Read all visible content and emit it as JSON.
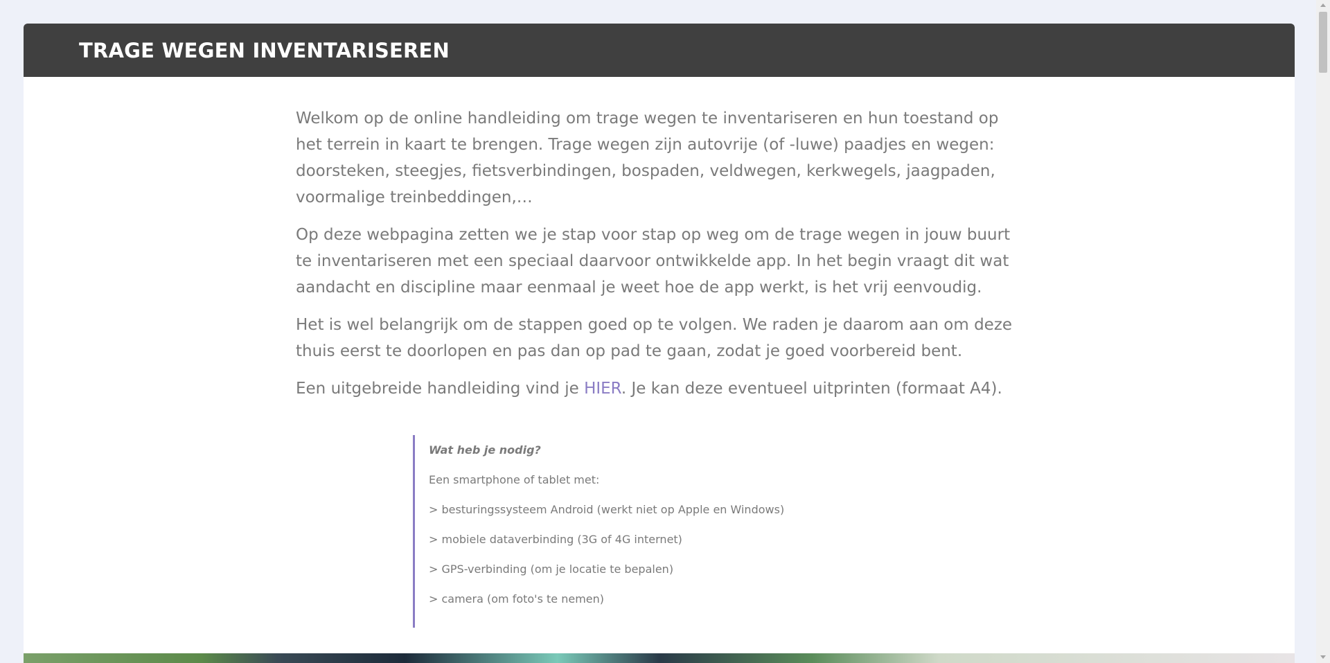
{
  "header": {
    "title": "TRAGE WEGEN INVENTARISEREN"
  },
  "intro": {
    "p1": "Welkom op de online handleiding om trage wegen te inventariseren en hun toestand op het terrein in kaart te brengen. Trage wegen zijn autovrije (of -luwe) paadjes en wegen: doorsteken, steegjes, fietsverbindingen, bospaden, veldwegen, kerkwegels, jaagpaden, voormalige treinbeddingen,…",
    "p2": "Op deze webpagina zetten we je stap voor stap op weg om de trage wegen in jouw buurt te inventariseren met een speciaal daarvoor ontwikkelde app. In het begin vraagt dit wat aandacht en discipline maar eenmaal je weet hoe de app werkt, is het vrij eenvoudig.",
    "p3": "Het is wel belangrijk om de stappen goed op te volgen. We raden je daarom aan om deze thuis eerst te doorlopen en pas dan op pad te gaan, zodat je goed voorbereid bent.",
    "p4_before": "Een uitgebreide handleiding vind je ",
    "p4_link": "HIER",
    "p4_after": ". Je kan deze eventueel uitprinten (formaat A4)."
  },
  "requirements": {
    "title": "Wat heb je nodig?",
    "subtitle": "Een smartphone of tablet met:",
    "items": [
      "> besturingssysteem Android (werkt niet op Apple en Windows)",
      "> mobiele dataverbinding (3G of 4G internet)",
      "> GPS-verbinding (om je locatie te bepalen)",
      "> camera (om foto's te nemen)"
    ]
  },
  "colors": {
    "header_bg": "#404040",
    "accent": "#8a7cc4",
    "text": "#7a7a7a",
    "page_bg": "#eef1f9"
  }
}
